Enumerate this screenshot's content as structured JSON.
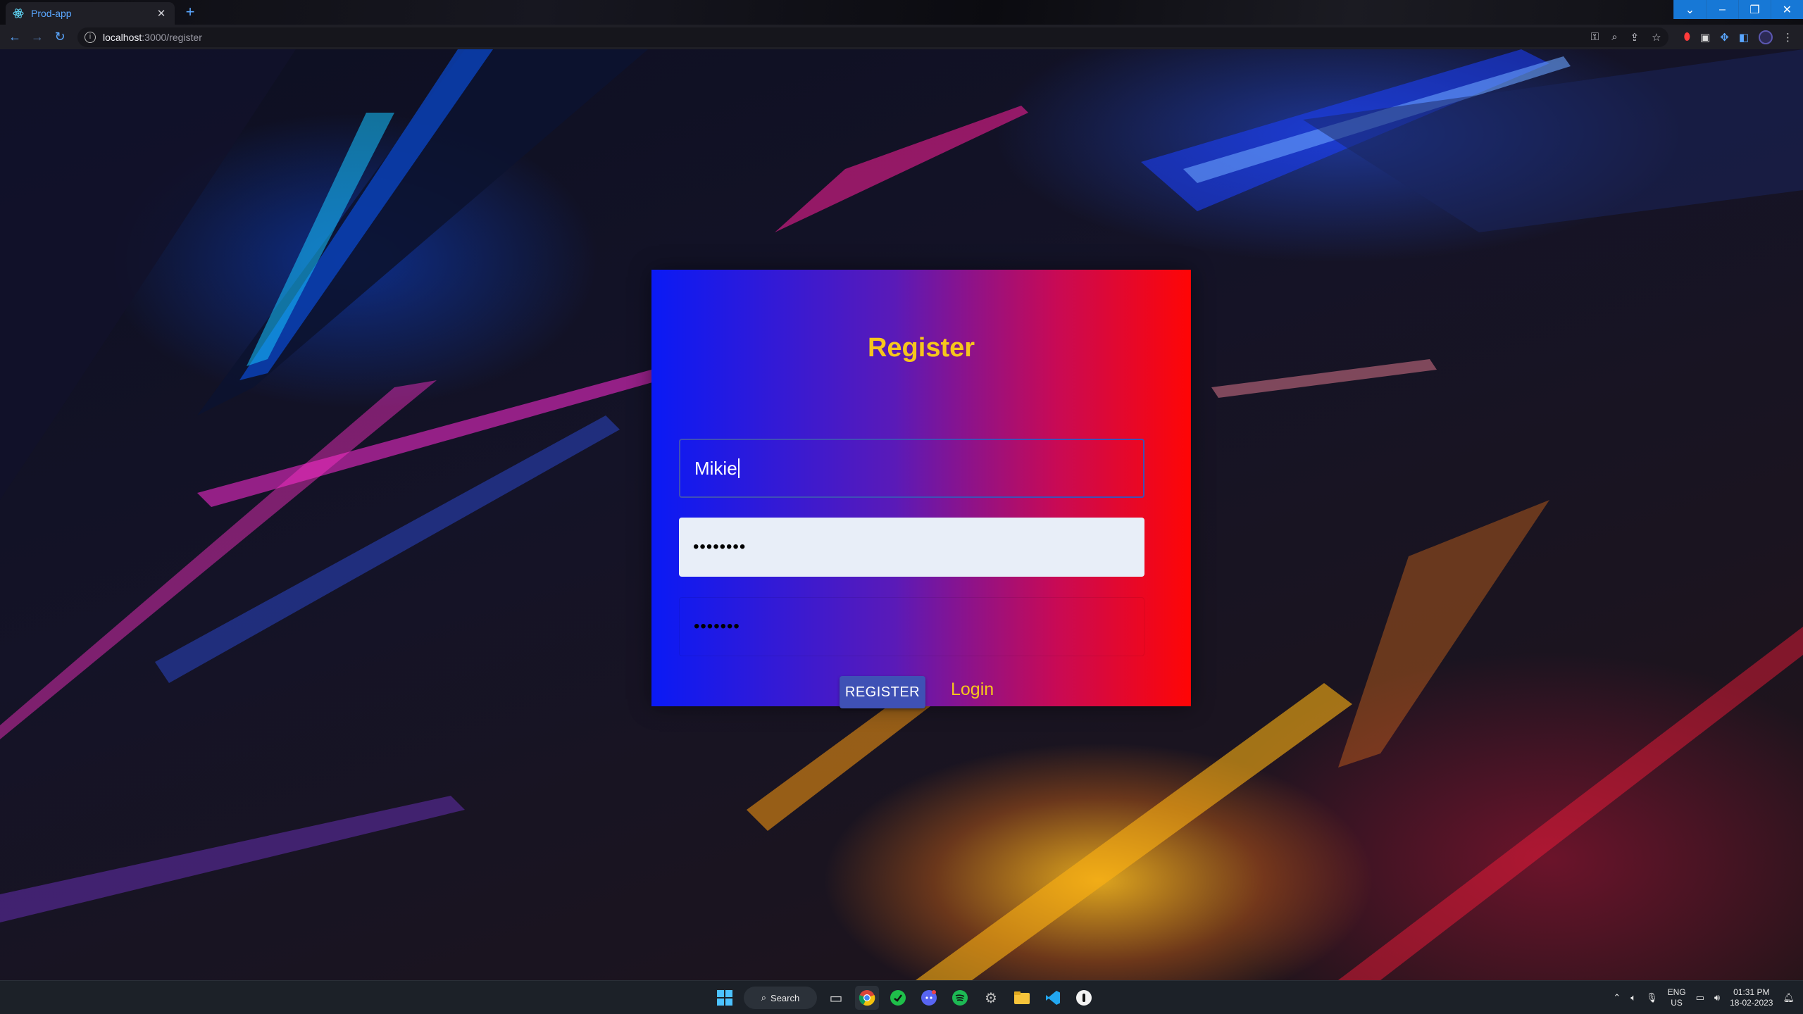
{
  "browser": {
    "tab_title": "Prod-app",
    "tab_close": "✕",
    "new_tab": "+",
    "url_host": "localhost",
    "url_path": ":3000/register",
    "window_controls": [
      "⌄",
      "–",
      "❐",
      "✕"
    ]
  },
  "form": {
    "title": "Register",
    "username_value": "Mikie",
    "password_value": "••••••••",
    "confirm_value": "•••••••",
    "register_label": "REGISTER",
    "login_label": "Login"
  },
  "taskbar": {
    "search_label": "Search",
    "lang_top": "ENG",
    "lang_bottom": "US",
    "time": "01:31 PM",
    "date": "18-02-2023"
  },
  "colors": {
    "card_left": "#0a1af5",
    "card_right": "#ff0505",
    "title_color": "#f6c61c",
    "button_color": "#3f51b5",
    "accent_blue": "#5aa7ff"
  }
}
